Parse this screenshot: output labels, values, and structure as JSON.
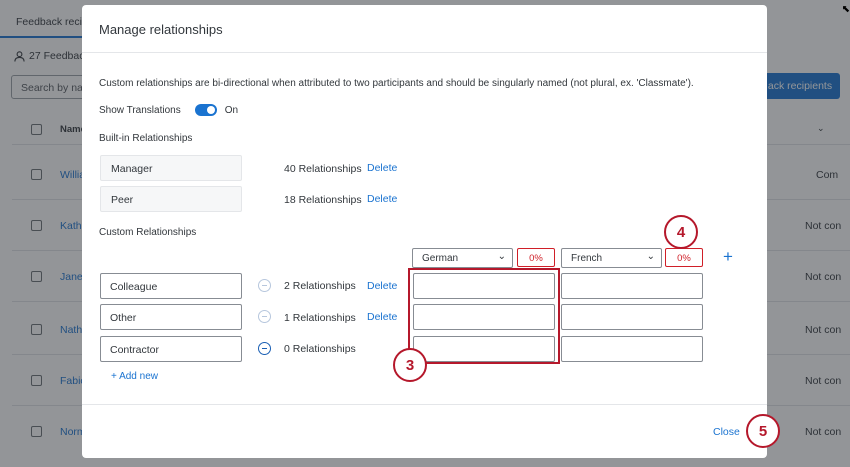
{
  "background": {
    "tab_label": "Feedback recip",
    "count_label": "27 Feedbac",
    "search_placeholder": "Search by nan",
    "add_button": "ack recipients",
    "name_header": "Name",
    "rows": [
      {
        "name": "Willia",
        "status": "Com"
      },
      {
        "name": "Kathl",
        "status": "Not con"
      },
      {
        "name": "Janet",
        "status": "Not con"
      },
      {
        "name": "Natha",
        "status": "Not con"
      },
      {
        "name": "Fabio",
        "status": "Not con"
      },
      {
        "name": "Norm",
        "status": "Not con"
      }
    ]
  },
  "modal": {
    "title": "Manage relationships",
    "description": "Custom relationships are bi-directional when attributed to two participants and should be singularly named (not plural, ex. 'Classmate').",
    "show_translations_label": "Show Translations",
    "show_translations_state": "On",
    "builtin_label": "Built-in Relationships",
    "builtin": [
      {
        "name": "Manager",
        "count": "40 Relationships",
        "action": "Delete"
      },
      {
        "name": "Peer",
        "count": "18 Relationships",
        "action": "Delete"
      }
    ],
    "custom_label": "Custom Relationships",
    "languages": [
      {
        "name": "German",
        "percent": "0%"
      },
      {
        "name": "French",
        "percent": "0%"
      }
    ],
    "custom": [
      {
        "name": "Colleague",
        "count": "2 Relationships",
        "action": "Delete"
      },
      {
        "name": "Other",
        "count": "1 Relationships",
        "action": "Delete"
      },
      {
        "name": "Contractor",
        "count": "0 Relationships",
        "action": ""
      }
    ],
    "add_new": "+ Add new",
    "close": "Close"
  },
  "callouts": [
    "3",
    "4",
    "5"
  ],
  "colors": {
    "accent": "#1a73d0",
    "error": "#d01f28",
    "callout": "#b5182b"
  }
}
